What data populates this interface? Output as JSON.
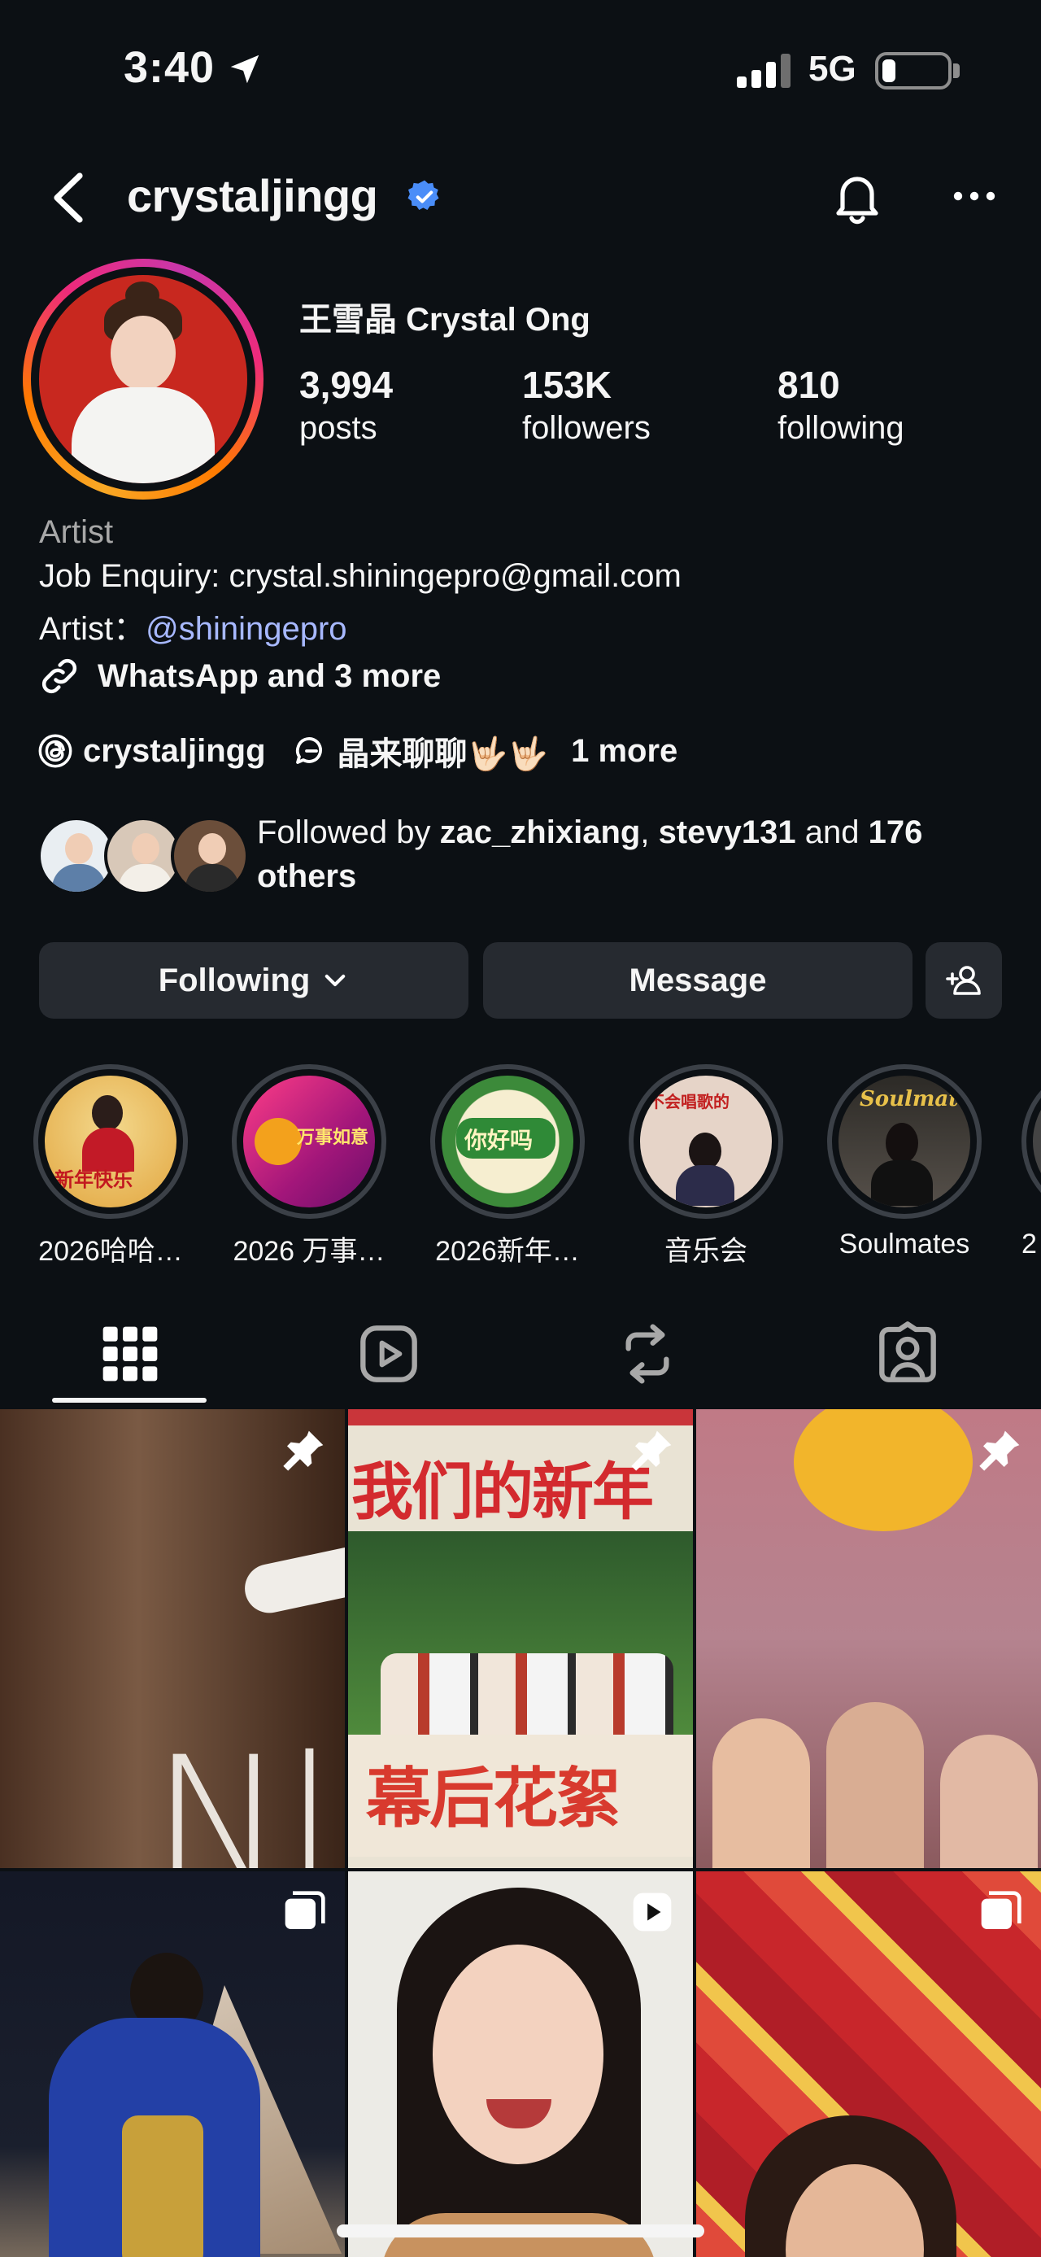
{
  "status_bar": {
    "time": "3:40",
    "network": "5G"
  },
  "header": {
    "username": "crystaljingg"
  },
  "profile": {
    "display_name": "王雪晶 Crystal Ong",
    "stats": [
      {
        "value": "3,994",
        "label": "posts"
      },
      {
        "value": "153K",
        "label": "followers"
      },
      {
        "value": "810",
        "label": "following"
      }
    ],
    "category": "Artist",
    "email_line": "Job Enquiry: crystal.shiningepro@gmail.com",
    "artist_prefix": "Artist：",
    "artist_mention": "@shiningepro",
    "link_text": "WhatsApp and 3 more",
    "threads_handle": "crystaljingg",
    "chat_text": "晶来聊聊🤟🏻🤟🏻",
    "more_links": "1 more"
  },
  "followed_by": {
    "prefix": "Followed by ",
    "user1": "zac_zhixiang",
    "sep": ", ",
    "user2": "stevy131",
    "and": " and ",
    "others": "176 others"
  },
  "buttons": {
    "following": "Following",
    "message": "Message"
  },
  "highlights": [
    {
      "label": "2026哈哈…",
      "art": "新年快乐"
    },
    {
      "label": "2026 万事…",
      "art": "万事如意"
    },
    {
      "label": "2026新年…",
      "art": "你好吗"
    },
    {
      "label": "音乐会",
      "art": "不会唱歌的"
    },
    {
      "label": "Soulmates",
      "art": "Soulmate"
    },
    {
      "label": "2"
    }
  ],
  "grid": {
    "post2_title": "我们的新年",
    "post2_subtitle": "幕后花絮",
    "post1_text": "Nl"
  },
  "colors": {
    "accent_link": "#a7b8ff",
    "background": "#0c1014",
    "button": "#262a30",
    "verified": "#4a8df8"
  }
}
